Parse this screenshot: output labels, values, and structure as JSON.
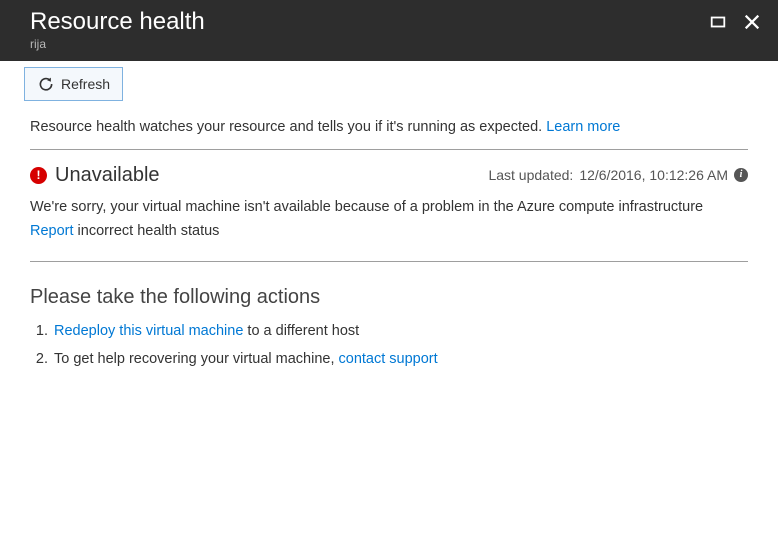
{
  "header": {
    "title": "Resource health",
    "subtitle": "rija"
  },
  "toolbar": {
    "refresh_label": "Refresh"
  },
  "intro": {
    "text": "Resource health watches your resource and tells you if it's running as expected. ",
    "link": "Learn more"
  },
  "status": {
    "label": "Unavailable",
    "last_updated_prefix": "Last updated: ",
    "last_updated_value": "12/6/2016, 10:12:26 AM"
  },
  "description": "We're sorry, your virtual machine isn't available because of a problem in the Azure compute infrastructure",
  "report": {
    "link": "Report",
    "rest": " incorrect health status"
  },
  "actions": {
    "title": "Please take the following actions",
    "items": [
      {
        "link": "Redeploy this virtual machine",
        "after": " to a different host"
      },
      {
        "before": "To get help recovering your virtual machine, ",
        "link": "contact support"
      }
    ]
  }
}
